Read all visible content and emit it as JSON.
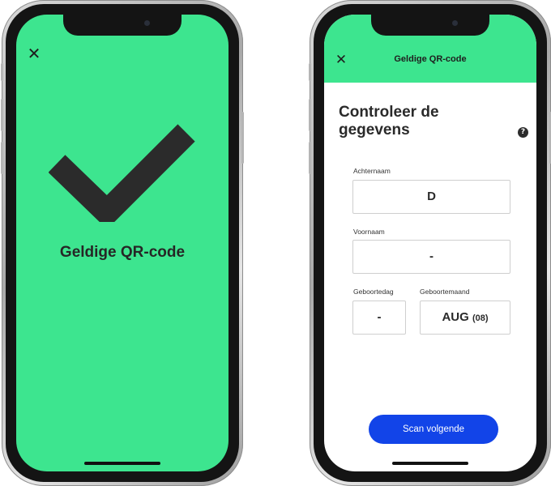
{
  "left_screen": {
    "close_icon": "close-icon",
    "close_glyph": "✕",
    "status_title": "Geldige QR-code",
    "check_color": "#2b2b2b",
    "background_color": "#3de58f"
  },
  "right_screen": {
    "header": {
      "close_glyph": "✕",
      "title": "Geldige QR-code"
    },
    "heading": "Controleer de gegevens",
    "help_glyph": "?",
    "fields": {
      "achternaam": {
        "label": "Achternaam",
        "value": "D"
      },
      "voornaam": {
        "label": "Voornaam",
        "value": "-"
      },
      "geboortedag": {
        "label": "Geboortedag",
        "value": "-"
      },
      "geboortemaand": {
        "label": "Geboortemaand",
        "value": "AUG",
        "code": "(08)"
      }
    },
    "scan_button_label": "Scan volgende",
    "accent_color": "#1244e8"
  }
}
